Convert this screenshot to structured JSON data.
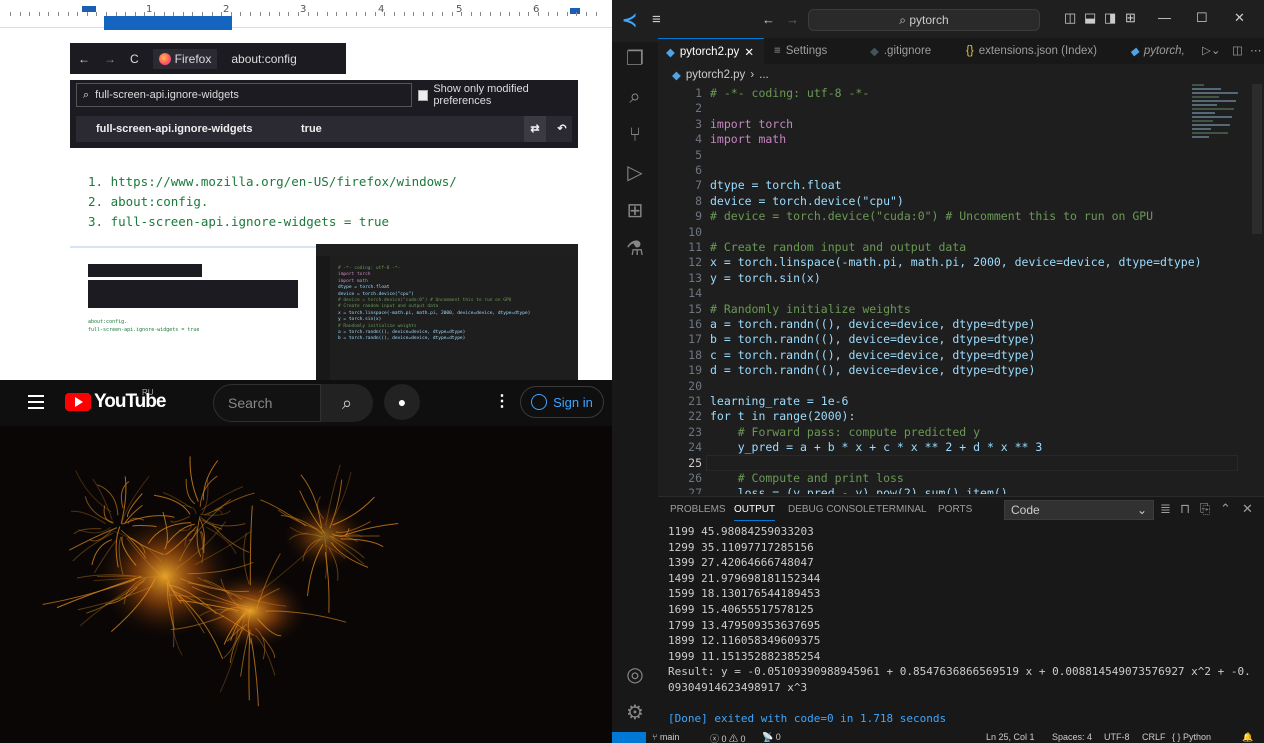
{
  "doc": {
    "ruler_numbers": [
      "1",
      "2",
      "3",
      "4",
      "5",
      "6"
    ],
    "firefox_label": "Firefox",
    "address": "about:config",
    "search_value": "full-screen-api.ignore-widgets",
    "show_modified_label": "Show only modified preferences",
    "pref_name": "full-screen-api.ignore-widgets",
    "pref_value": "true",
    "list": [
      "1. https://www.mozilla.org/en-US/firefox/windows/",
      "2. about:config.",
      "3. full-screen-api.ignore-widgets = true"
    ],
    "thumb_lines": [
      "about:config.",
      "full-screen-api.ignore-widgets = true"
    ]
  },
  "youtube": {
    "logo": "YouTube",
    "region": "RU",
    "search_placeholder": "Search",
    "sign_in": "Sign in"
  },
  "vscode": {
    "search_text": "pytorch",
    "tabs": [
      {
        "label": "pytorch2.py",
        "active": true
      },
      {
        "label": "Settings"
      },
      {
        "label": ".gitignore"
      },
      {
        "label": "extensions.json (Index)"
      },
      {
        "label": "pytorch,"
      }
    ],
    "breadcrumb": [
      "pytorch2.py",
      "..."
    ],
    "code": [
      {
        "n": "1",
        "t": "# -*- coding: utf-8 -*-",
        "c": "cm"
      },
      {
        "n": "2",
        "t": ""
      },
      {
        "n": "3",
        "t": "import torch",
        "c": "kw"
      },
      {
        "n": "4",
        "t": "import math",
        "c": "kw"
      },
      {
        "n": "5",
        "t": ""
      },
      {
        "n": "6",
        "t": ""
      },
      {
        "n": "7",
        "t": "dtype = torch.float"
      },
      {
        "n": "8",
        "t": "device = torch.device(\"cpu\")"
      },
      {
        "n": "9",
        "t": "# device = torch.device(\"cuda:0\") # Uncomment this to run on GPU",
        "c": "cm"
      },
      {
        "n": "10",
        "t": ""
      },
      {
        "n": "11",
        "t": "# Create random input and output data",
        "c": "cm"
      },
      {
        "n": "12",
        "t": "x = torch.linspace(-math.pi, math.pi, 2000, device=device, dtype=dtype)"
      },
      {
        "n": "13",
        "t": "y = torch.sin(x)"
      },
      {
        "n": "14",
        "t": ""
      },
      {
        "n": "15",
        "t": "# Randomly initialize weights",
        "c": "cm"
      },
      {
        "n": "16",
        "t": "a = torch.randn((), device=device, dtype=dtype)"
      },
      {
        "n": "17",
        "t": "b = torch.randn((), device=device, dtype=dtype)"
      },
      {
        "n": "18",
        "t": "c = torch.randn((), device=device, dtype=dtype)"
      },
      {
        "n": "19",
        "t": "d = torch.randn((), device=device, dtype=dtype)"
      },
      {
        "n": "20",
        "t": ""
      },
      {
        "n": "21",
        "t": "learning_rate = 1e-6"
      },
      {
        "n": "22",
        "t": "for t in range(2000):"
      },
      {
        "n": "23",
        "t": "    # Forward pass: compute predicted y",
        "c": "cm"
      },
      {
        "n": "24",
        "t": "    y_pred = a + b * x + c * x ** 2 + d * x ** 3"
      },
      {
        "n": "25",
        "t": ""
      },
      {
        "n": "26",
        "t": "    # Compute and print loss",
        "c": "cm"
      },
      {
        "n": "27",
        "t": "    loss = (y_pred - y).pow(2).sum().item()"
      }
    ],
    "panel_tabs": [
      "PROBLEMS",
      "OUTPUT",
      "DEBUG CONSOLE",
      "TERMINAL",
      "PORTS"
    ],
    "panel_select": "Code",
    "output": [
      "1199 45.98084259033203",
      "1299 35.11097717285156",
      "1399 27.42064666748047",
      "1499 21.979698181152344",
      "1599 18.130176544189453",
      "1699 15.40655517578125",
      "1799 13.479509353637695",
      "1899 12.116058349609375",
      "1999 11.151352882385254",
      "Result: y = -0.05109390988945961 + 0.8547636866569519 x + 0.008814549073576927 x^2 + -0.",
      "09304914623498917 x^3",
      "",
      "[Done] exited with code=0 in 1.718 seconds"
    ],
    "status": {
      "branch": "main",
      "errors": "ⓧ 0 ⚠ 0",
      "ports": "📡 0",
      "position": "Ln 25, Col 1",
      "spaces": "Spaces: 4",
      "encoding": "UTF-8",
      "eol": "CRLF",
      "language": "{ } Python"
    }
  }
}
